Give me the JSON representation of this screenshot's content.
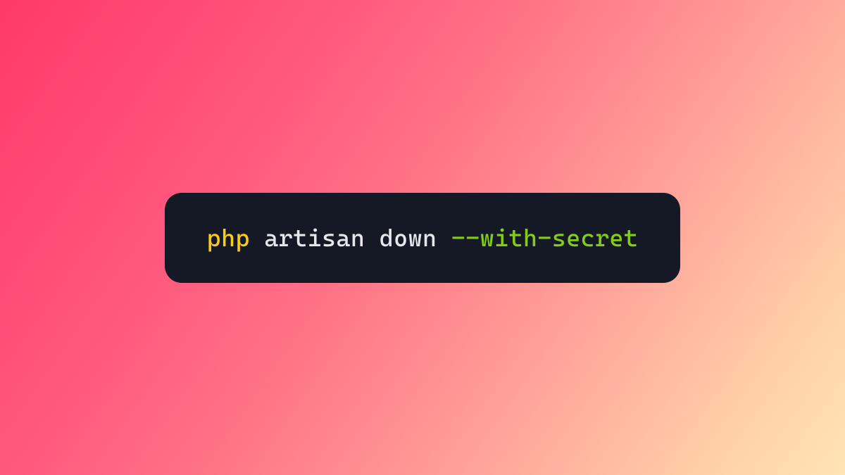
{
  "code": {
    "command": "php",
    "args": " artisan down ",
    "flag": "--with-secret"
  },
  "colors": {
    "background_start": "#ff3a6a",
    "background_end": "#ffe4b5",
    "code_bg": "#141925",
    "command_color": "#facc15",
    "args_color": "#e5e7eb",
    "flag_color": "#84cc16"
  }
}
